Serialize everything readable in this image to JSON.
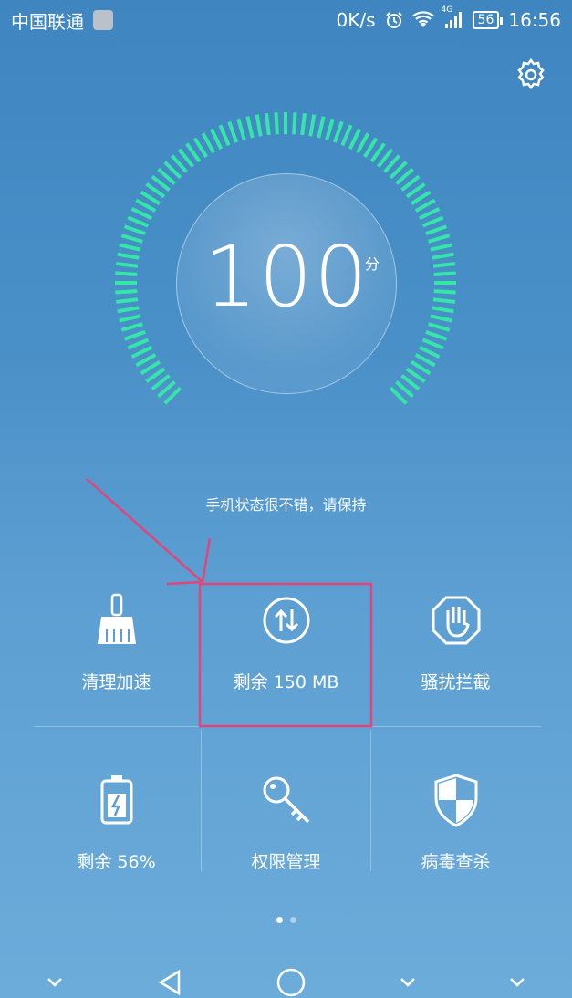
{
  "status_bar": {
    "carrier": "中国联通",
    "speed": "0K/s",
    "network": "4G",
    "battery": "56",
    "time": "16:56"
  },
  "score": {
    "value": "100",
    "unit": "分",
    "message": "手机状态很不错，请保持"
  },
  "tiles": [
    {
      "label": "清理加速",
      "icon": "broom-icon"
    },
    {
      "label": "剩余 150 MB",
      "icon": "data-transfer-icon"
    },
    {
      "label": "骚扰拦截",
      "icon": "stop-hand-icon"
    },
    {
      "label": "剩余 56%",
      "icon": "battery-icon"
    },
    {
      "label": "权限管理",
      "icon": "key-icon"
    },
    {
      "label": "病毒查杀",
      "icon": "shield-icon"
    }
  ],
  "pager": {
    "pages": 2,
    "active": 1
  },
  "colors": {
    "accent_gauge": "#35e6a8",
    "annotation": "#e0457b",
    "background_top": "#3f86c1",
    "background_bottom": "#6cacdb"
  }
}
